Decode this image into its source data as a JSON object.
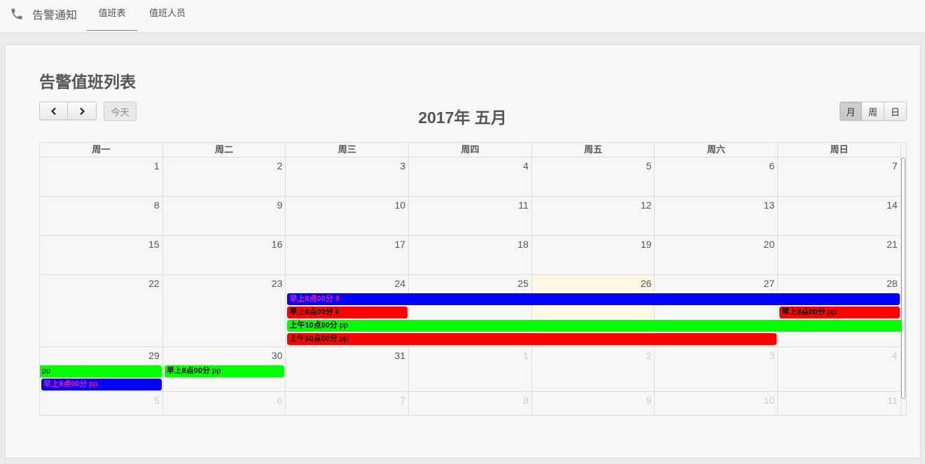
{
  "nav": {
    "icon": "phone-icon",
    "title": "告警通知",
    "tabs": [
      {
        "label": "值班表",
        "active": true
      },
      {
        "label": "值班人员",
        "active": false
      }
    ]
  },
  "page_title": "告警值班列表",
  "toolbar": {
    "prev_icon": "chevron-left-icon",
    "next_icon": "chevron-right-icon",
    "today_label": "今天",
    "calendar_title": "2017年 五月",
    "views": [
      {
        "label": "月",
        "active": true
      },
      {
        "label": "周",
        "active": false
      },
      {
        "label": "日",
        "active": false
      }
    ]
  },
  "calendar": {
    "weekdays": [
      "周一",
      "周二",
      "周三",
      "周四",
      "周五",
      "周六",
      "周日"
    ],
    "weeks": [
      [
        {
          "d": "1"
        },
        {
          "d": "2"
        },
        {
          "d": "3"
        },
        {
          "d": "4"
        },
        {
          "d": "5"
        },
        {
          "d": "6"
        },
        {
          "d": "7"
        }
      ],
      [
        {
          "d": "8"
        },
        {
          "d": "9"
        },
        {
          "d": "10"
        },
        {
          "d": "11"
        },
        {
          "d": "12"
        },
        {
          "d": "13"
        },
        {
          "d": "14"
        }
      ],
      [
        {
          "d": "15"
        },
        {
          "d": "16"
        },
        {
          "d": "17"
        },
        {
          "d": "18"
        },
        {
          "d": "19"
        },
        {
          "d": "20"
        },
        {
          "d": "21"
        }
      ],
      [
        {
          "d": "22"
        },
        {
          "d": "23"
        },
        {
          "d": "24"
        },
        {
          "d": "25"
        },
        {
          "d": "26",
          "today": true
        },
        {
          "d": "27"
        },
        {
          "d": "28"
        }
      ],
      [
        {
          "d": "29"
        },
        {
          "d": "30"
        },
        {
          "d": "31"
        },
        {
          "d": "1",
          "other": true
        },
        {
          "d": "2",
          "other": true
        },
        {
          "d": "3",
          "other": true
        },
        {
          "d": "4",
          "other": true
        }
      ],
      [
        {
          "d": "5",
          "other": true
        },
        {
          "d": "6",
          "other": true
        },
        {
          "d": "7",
          "other": true
        },
        {
          "d": "8",
          "other": true
        },
        {
          "d": "9",
          "other": true
        },
        {
          "d": "10",
          "other": true
        },
        {
          "d": "11",
          "other": true
        }
      ]
    ],
    "events": [
      {
        "week": 3,
        "start": 2,
        "end": 6,
        "slot": 0,
        "time": "早上8点00分",
        "title": "ll",
        "bg": "#0000ff",
        "fg": "#ff1493"
      },
      {
        "week": 3,
        "start": 2,
        "end": 2,
        "slot": 1,
        "time": "早上8点00分",
        "title": "ll",
        "bg": "#ff0000",
        "fg": "#000000"
      },
      {
        "week": 3,
        "start": 6,
        "end": 6,
        "slot": 1,
        "time": "早上8点00分",
        "title": "pp",
        "bg": "#ff0000",
        "fg": "#000000"
      },
      {
        "week": 3,
        "start": 2,
        "end": 6,
        "slot": 2,
        "time": "上午10点00分",
        "title": "pp",
        "bg": "#00ff00",
        "fg": "#000000",
        "cont_right": true
      },
      {
        "week": 3,
        "start": 2,
        "end": 5,
        "slot": 3,
        "time": "上午10点00分",
        "title": "pp",
        "bg": "#ff0000",
        "fg": "#000000"
      },
      {
        "week": 4,
        "start": 0,
        "end": 0,
        "slot": 0,
        "time": "",
        "title": "pp",
        "bg": "#00ff00",
        "fg": "#000000",
        "cont_left": true
      },
      {
        "week": 4,
        "start": 1,
        "end": 1,
        "slot": 0,
        "time": "早上8点00分",
        "title": "pp",
        "bg": "#00ff00",
        "fg": "#000000"
      },
      {
        "week": 4,
        "start": 0,
        "end": 0,
        "slot": 1,
        "time": "早上8点00分",
        "title": "pp",
        "bg": "#0000ff",
        "fg": "#ff1493"
      }
    ]
  }
}
